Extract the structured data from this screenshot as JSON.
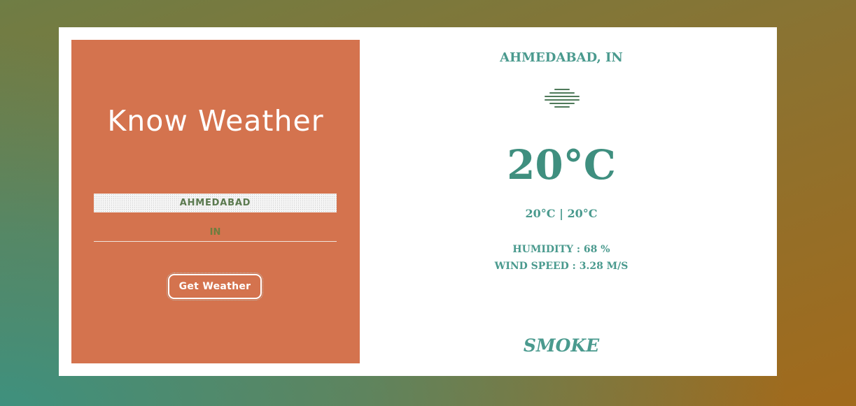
{
  "app": {
    "title": "Know Weather"
  },
  "form": {
    "city_value": "AHMEDABAD",
    "country_value": "IN",
    "button_label": "Get Weather"
  },
  "weather": {
    "location": "AHMEDABAD, IN",
    "icon": "haze-lines-icon",
    "temperature": "20°C",
    "temp_range": "20°C | 20°C",
    "humidity": "HUMIDITY : 68 %",
    "wind_speed": "WIND SPEED : 3.28 M/S",
    "condition": "SMOKE"
  },
  "colors": {
    "left_panel": "#d4734e",
    "accent_text": "#4a9a8e",
    "input_text": "#5b7a4f",
    "icon_color": "#4f7a5a"
  }
}
